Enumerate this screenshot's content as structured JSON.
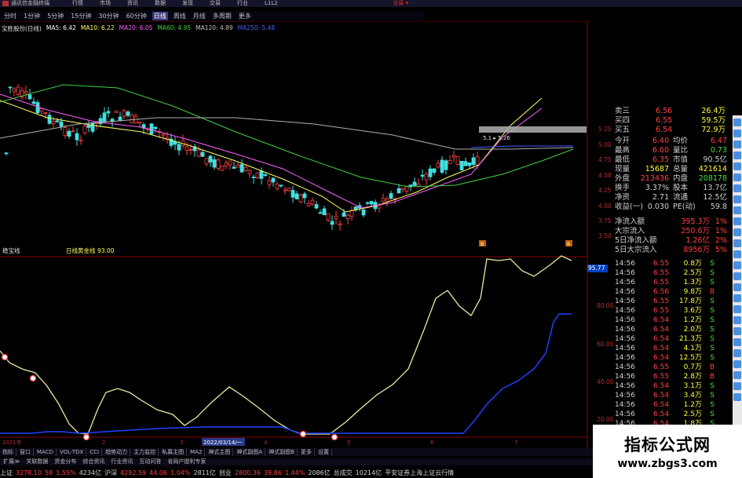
{
  "window": {
    "app_name": "通达信金融终端",
    "menu": [
      "行情",
      "市场",
      "资讯",
      "数据",
      "发现",
      "交易",
      "行业",
      "L1L2"
    ],
    "right_label": "交易 ▾"
  },
  "period_tabs": [
    "分时",
    "1分钟",
    "5分钟",
    "15分钟",
    "30分钟",
    "60分钟",
    "日线",
    "周线",
    "月线",
    "多周期",
    "更多"
  ],
  "active_period": "日线",
  "kline_header": {
    "stock": "宝胜股份(日线)",
    "items": [
      {
        "label": "MA5: 6.42",
        "color": "#ffffff"
      },
      {
        "label": "MA10: 6.22",
        "color": "#ffff60"
      },
      {
        "label": "MA20: 6.05",
        "color": "#ff60ff"
      },
      {
        "label": "MA60: 4.95",
        "color": "#40d040"
      },
      {
        "label": "MA120: 4.89",
        "color": "#c0c0c0"
      },
      {
        "label": "MA250: 5.48",
        "color": "#4060ff"
      }
    ]
  },
  "kline_price_labels": [
    "5.25",
    "5.00",
    "4.75",
    "4.50",
    "4.25",
    "4.00",
    "3.75",
    "3.50"
  ],
  "kline_annotation": "5.1 ▸ 5.26",
  "kline_markers": [
    "B",
    "B"
  ],
  "indicator_header": {
    "name": "稳宝线",
    "series": "日线黄金线",
    "value": "93.00"
  },
  "indicator_labels": [
    "95.77",
    "80.00",
    "60.00",
    "40.00",
    "20.00"
  ],
  "date_axis": {
    "year": "2021年",
    "highlight": "2022/03/14/一",
    "ticks": [
      "2",
      "3",
      "4",
      "5",
      "6",
      "7"
    ]
  },
  "quote": {
    "order_book": [
      {
        "label": "卖三",
        "price": "6.56",
        "vol": "26.4万"
      },
      {
        "label": "买四",
        "price": "6.55",
        "vol": "59.5万"
      },
      {
        "label": "买五",
        "price": "6.54",
        "vol": "72.9万"
      }
    ],
    "stats": [
      {
        "l1": "今开",
        "v1": "6.40",
        "c1": "#ff4040",
        "l2": "均价",
        "v2": "6.47",
        "c2": "#ff4040"
      },
      {
        "l1": "最高",
        "v1": "6.60",
        "c1": "#ff4040",
        "l2": "量比",
        "v2": "0.73",
        "c2": "#40e040"
      },
      {
        "l1": "最低",
        "v1": "6.35",
        "c1": "#ff4040",
        "l2": "市值",
        "v2": "90.5亿",
        "c2": "#d0d0d0"
      },
      {
        "l1": "现量",
        "v1": "15687",
        "c1": "#ffff40",
        "l2": "总量",
        "v2": "421614",
        "c2": "#ffff40"
      },
      {
        "l1": "外盘",
        "v1": "213436",
        "c1": "#ff4040",
        "l2": "内盘",
        "v2": "208178",
        "c2": "#40e040"
      },
      {
        "l1": "换手",
        "v1": "3.37%",
        "c1": "#d0d0d0",
        "l2": "股本",
        "v2": "13.7亿",
        "c2": "#d0d0d0"
      },
      {
        "l1": "净资",
        "v1": "2.71",
        "c1": "#d0d0d0",
        "l2": "流通",
        "v2": "12.5亿",
        "c2": "#d0d0d0"
      },
      {
        "l1": "收益(一)",
        "v1": "0.030",
        "c1": "#d0d0d0",
        "l2": "PE(动)",
        "v2": "59.8",
        "c2": "#d0d0d0"
      }
    ],
    "flows": [
      {
        "label": "净流入额",
        "value": "395.3万",
        "pct": "1%"
      },
      {
        "label": "大宗流入",
        "value": "250.6万",
        "pct": "1%"
      },
      {
        "label": "5日净流入额",
        "value": "1.26亿",
        "pct": "2%"
      },
      {
        "label": "5日大宗流入",
        "value": "8956万",
        "pct": "5%"
      }
    ],
    "ticks": [
      {
        "t": "14:56",
        "p": "6.55",
        "v": "0.8万",
        "s": "S"
      },
      {
        "t": "14:56",
        "p": "6.55",
        "v": "2.5万",
        "s": "S"
      },
      {
        "t": "14:56",
        "p": "6.55",
        "v": "1.3万",
        "s": "S"
      },
      {
        "t": "14:56",
        "p": "6.56",
        "v": "9.8万",
        "s": "B"
      },
      {
        "t": "14:56",
        "p": "6.55",
        "v": "17.8万",
        "s": "S"
      },
      {
        "t": "14:56",
        "p": "6.55",
        "v": "3.6万",
        "s": "S"
      },
      {
        "t": "14:56",
        "p": "6.54",
        "v": "1.2万",
        "s": "S"
      },
      {
        "t": "14:56",
        "p": "6.54",
        "v": "2.0万",
        "s": "S"
      },
      {
        "t": "14:56",
        "p": "6.54",
        "v": "21.3万",
        "s": "S"
      },
      {
        "t": "14:56",
        "p": "6.54",
        "v": "4.1万",
        "s": "S"
      },
      {
        "t": "14:56",
        "p": "6.54",
        "v": "12.5万",
        "s": "S"
      },
      {
        "t": "14:56",
        "p": "6.55",
        "v": "0.7万",
        "s": "B"
      },
      {
        "t": "14:56",
        "p": "6.55",
        "v": "2.8万",
        "s": "B"
      },
      {
        "t": "14:56",
        "p": "6.54",
        "v": "3.1万",
        "s": "S"
      },
      {
        "t": "14:56",
        "p": "6.54",
        "v": "3.4万",
        "s": "S"
      },
      {
        "t": "14:56",
        "p": "6.54",
        "v": "1.2万",
        "s": "S"
      },
      {
        "t": "14:56",
        "p": "6.54",
        "v": "2.5万",
        "s": "S"
      },
      {
        "t": "14:56",
        "p": "6.54",
        "v": "1.8万",
        "s": "S"
      }
    ]
  },
  "indicator_tabs": [
    "指标",
    "窗口",
    "MACD",
    "VOL-TDX",
    "CCI",
    "趋势动力",
    "主力监控",
    "私募主图",
    "MA2",
    "神式主图",
    "神式副图A",
    "神式副图B",
    "更多",
    "设置"
  ],
  "feature_bar": [
    "扩展≫",
    "关联数据",
    "资金分布",
    "综合资讯",
    "行业资讯",
    "互动问答",
    "省局户提利专家"
  ],
  "status_bar": [
    {
      "text": "上证",
      "color": "#d0d0d0"
    },
    {
      "text": "3278.10",
      "color": "#ff4040"
    },
    {
      "text": "58",
      "color": "#ff4040"
    },
    {
      "text": "1.55%",
      "color": "#ff4040"
    },
    {
      "text": "4234亿",
      "color": "#d0d0d0"
    },
    {
      "text": "沪深",
      "color": "#d0d0d0"
    },
    {
      "text": "4292.59",
      "color": "#ff4040"
    },
    {
      "text": "44.06",
      "color": "#ff4040"
    },
    {
      "text": "1.04%",
      "color": "#ff4040"
    },
    {
      "text": "2811亿",
      "color": "#d0d0d0"
    },
    {
      "text": "创业",
      "color": "#d0d0d0"
    },
    {
      "text": "2800.36",
      "color": "#ff4040"
    },
    {
      "text": "39.86",
      "color": "#ff4040"
    },
    {
      "text": "1.44%",
      "color": "#ff4040"
    },
    {
      "text": "2086亿",
      "color": "#d0d0d0"
    },
    {
      "text": "总成交",
      "color": "#d0d0d0"
    },
    {
      "text": "10214亿",
      "color": "#d0d0d0"
    },
    {
      "text": "平安证券上海上证云行情",
      "color": "#d0d0d0"
    }
  ],
  "watermark": {
    "title": "指标公式网",
    "url": "www.zbgs3.com"
  },
  "colors": {
    "up": "#ff4040",
    "down": "#40e0e0",
    "yellow": "#ffff60",
    "blue": "#2040ff",
    "cream": "#f0e6a0"
  }
}
